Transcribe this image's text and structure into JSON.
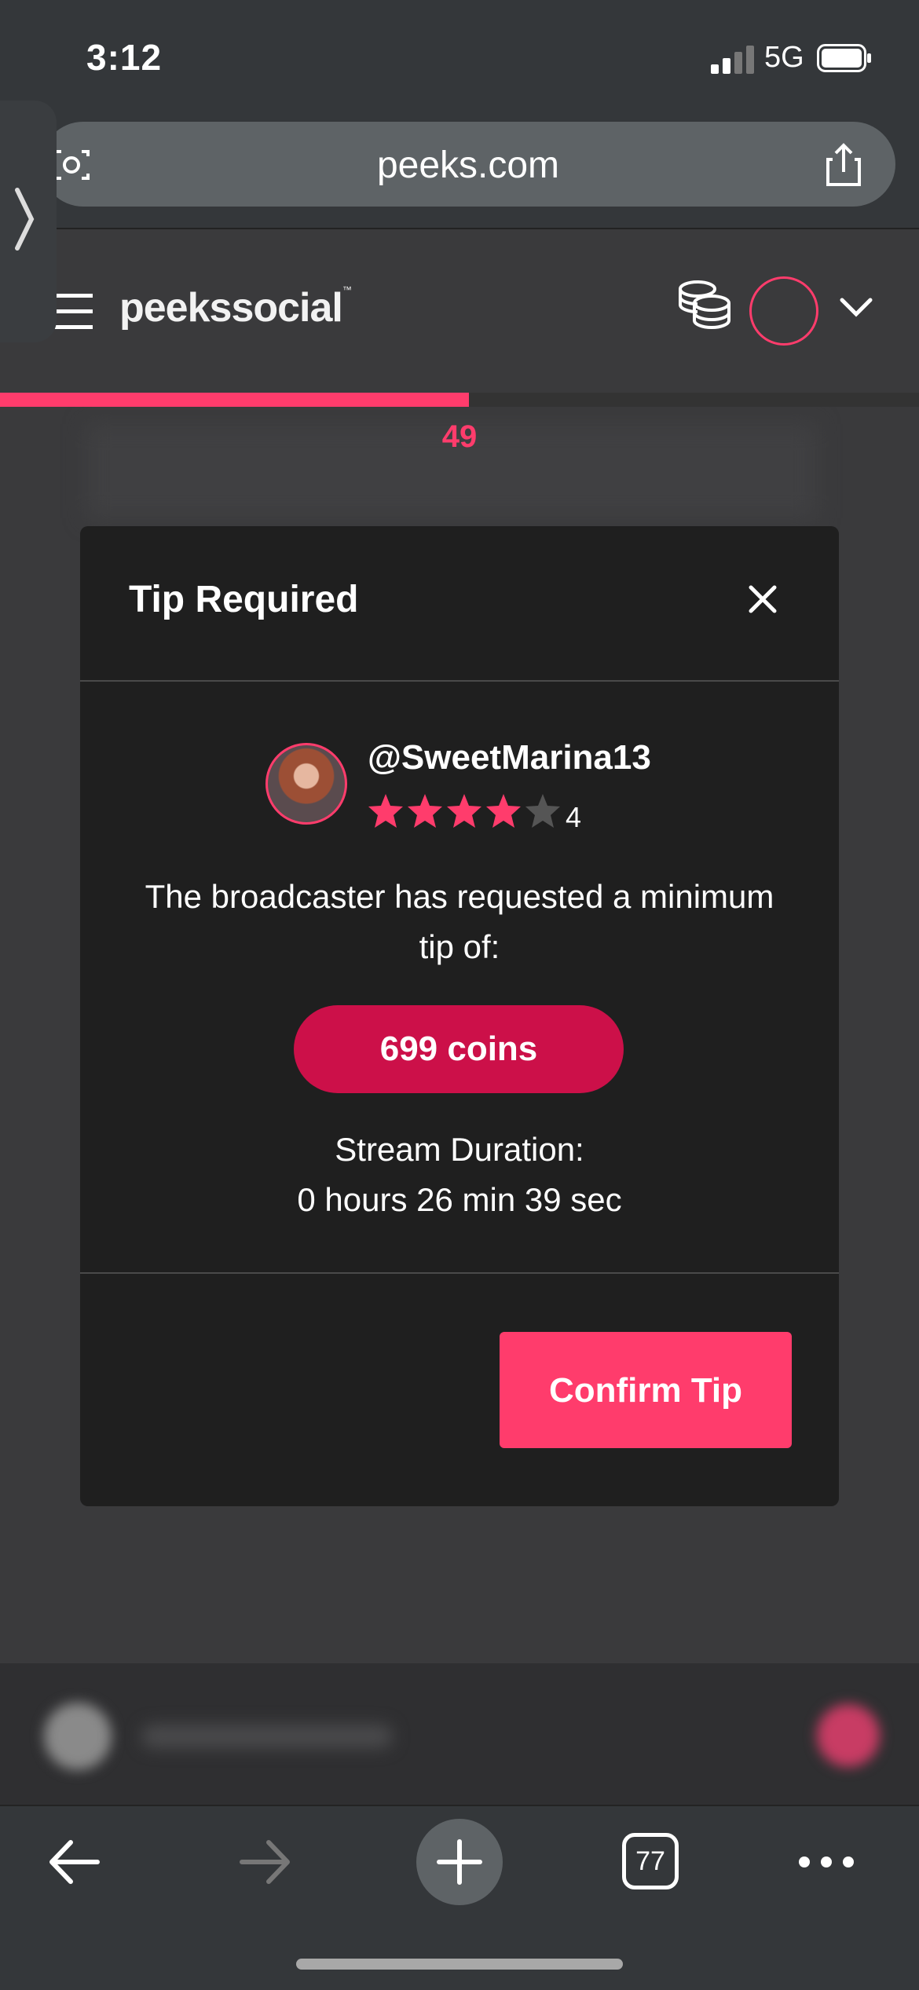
{
  "status_bar": {
    "time": "3:12",
    "network": "5G"
  },
  "browser": {
    "url": "peeks.com",
    "tab_count": "77"
  },
  "site": {
    "logo": "peekssocial",
    "logo_mark": "™"
  },
  "stream": {
    "countdown": "49",
    "progress_fraction": 0.51
  },
  "modal": {
    "title": "Tip Required",
    "username": "@SweetMarina13",
    "rating": 4,
    "rating_label": "4",
    "max_rating": 5,
    "request_text": "The broadcaster has requested a minimum tip of:",
    "min_tip": "699 coins",
    "duration_label": "Stream Duration:",
    "duration_value": "0 hours 26 min 39 sec",
    "confirm_label": "Confirm Tip"
  },
  "colors": {
    "accent": "#ff3c6c",
    "coin_badge": "#cc1049"
  }
}
